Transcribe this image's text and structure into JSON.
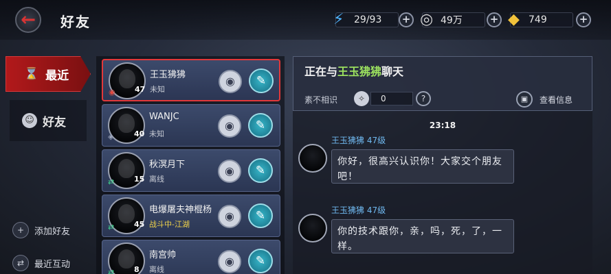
{
  "header": {
    "back_icon": "back-arrow-icon",
    "title": "好友",
    "stamina": "29/93",
    "silver": "49万",
    "gold": "749"
  },
  "tabs": [
    {
      "label": "最近",
      "icon": "hourglass-icon"
    },
    {
      "label": "好友",
      "icon": "friends-icon"
    }
  ],
  "side_actions": [
    {
      "label": "添加好友",
      "icon": "add-friend-icon"
    },
    {
      "label": "最近互动",
      "icon": "interaction-icon"
    }
  ],
  "friends": [
    {
      "name": "王玉狒狒",
      "status": "未知",
      "level": "47"
    },
    {
      "name": "WANJC",
      "status": "未知",
      "level": "40"
    },
    {
      "name": "秋溟月下",
      "status": "离线",
      "level": "15"
    },
    {
      "name": "电爆屠夫神棍杨",
      "status": "战斗中-江湖",
      "level": "45"
    },
    {
      "name": "南宫帅",
      "status": "离线",
      "level": "8"
    }
  ],
  "chat": {
    "title_prefix": "正在与",
    "partner": "王玉狒狒",
    "title_suffix": "聊天",
    "relation_label": "素不相识",
    "relation_value": "0",
    "help_symbol": "?",
    "view_info": "查看信息",
    "timestamp": "23:18",
    "messages": [
      {
        "sender": "王玉狒狒 47级",
        "text": "你好，很高兴认识你！大家交个朋友吧！"
      },
      {
        "sender": "王玉狒狒 47级",
        "text": "你的技术跟你，亲，吗，死，了，一样。"
      }
    ]
  },
  "colors": {
    "accent_red": "#b2191b",
    "highlight_green": "#9ce15f",
    "sender_blue": "#6fb8ef",
    "battle_yellow": "#f0d34a"
  }
}
